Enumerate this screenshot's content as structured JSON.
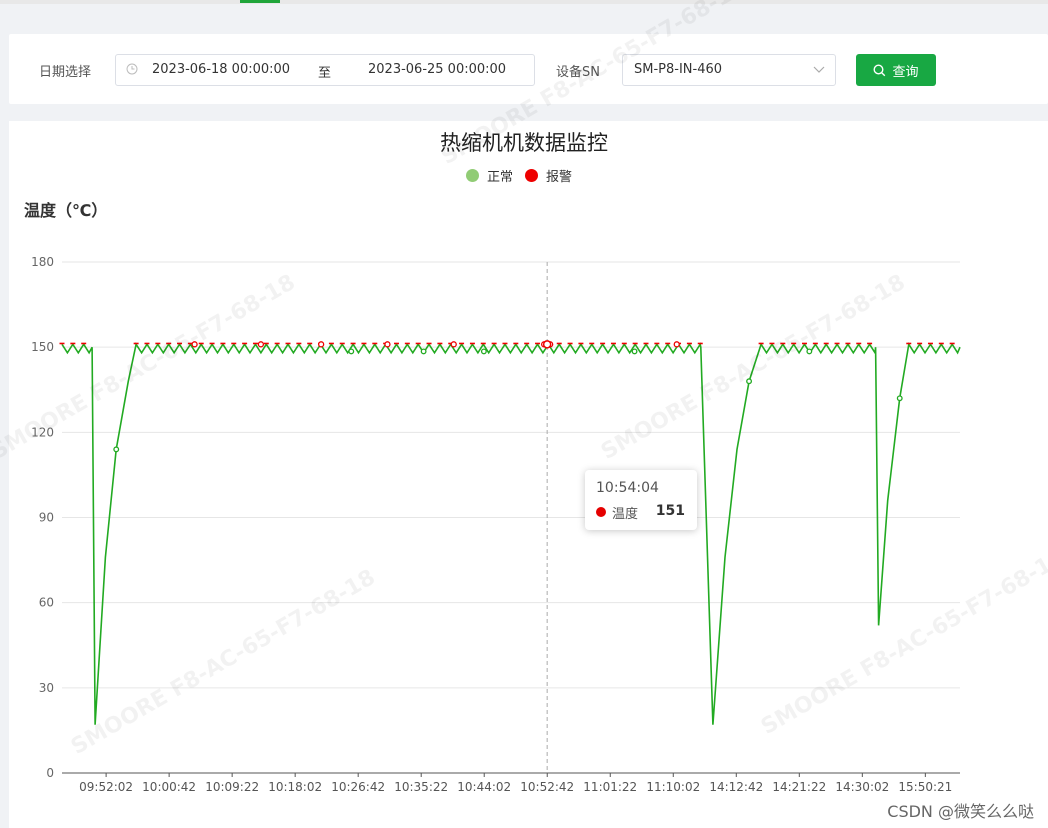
{
  "filter": {
    "date_label": "日期选择",
    "start_date": "2023-06-18 00:00:00",
    "range_separator": "至",
    "end_date": "2023-06-25 00:00:00",
    "sn_label": "设备SN",
    "sn_value": "SM-P8-IN-460",
    "query_label": "查询",
    "accent_color": "#18a843"
  },
  "watermark_text": "SMOORE  F8-AC-65-F7-68-18",
  "tooltip": {
    "time": "10:54:04",
    "series": "温度",
    "value": "151"
  },
  "credit": "CSDN @微笑么么哒",
  "chart_data": {
    "type": "line",
    "title": "热缩机机数据监控",
    "ylabel": "温度（℃）",
    "ylim": [
      0,
      180
    ],
    "yticks": [
      0,
      30,
      60,
      90,
      120,
      150,
      180
    ],
    "grid": true,
    "legend_position": "top-center",
    "legend": [
      {
        "name": "正常",
        "color": "#91cc75"
      },
      {
        "name": "报警",
        "color": "#ee0000"
      }
    ],
    "line_color": "#22aa22",
    "alarm_color": "#ee0000",
    "x_tick_labels": [
      "09:52:02",
      "10:00:42",
      "10:09:22",
      "10:18:02",
      "10:26:42",
      "10:35:22",
      "10:44:02",
      "10:52:42",
      "11:01:22",
      "11:10:02",
      "14:12:42",
      "14:21:22",
      "14:30:02",
      "15:50:21"
    ],
    "tick_index_start": 0.5,
    "series": [
      {
        "name": "温度",
        "points": [
          [
            0,
            150
          ],
          [
            5,
            150
          ],
          [
            5.5,
            17
          ],
          [
            7.2,
            76
          ],
          [
            9,
            114
          ],
          [
            11,
            138
          ],
          [
            12.3,
            150
          ],
          [
            106,
            150
          ],
          [
            108,
            17
          ],
          [
            110,
            76
          ],
          [
            112,
            114
          ],
          [
            114,
            138
          ],
          [
            116,
            150
          ],
          [
            135,
            150
          ],
          [
            135.5,
            52
          ],
          [
            137,
            96
          ],
          [
            139,
            132
          ],
          [
            140.5,
            150
          ],
          [
            149,
            150
          ]
        ],
        "alarm_marker_at": [
          22,
          33,
          43,
          54,
          65,
          80,
          81,
          102
        ],
        "normal_marker_at": [
          9,
          48,
          60,
          70,
          95,
          114,
          124,
          139
        ]
      }
    ],
    "highlight": {
      "x_label": "10:54:04",
      "value": 151
    }
  }
}
